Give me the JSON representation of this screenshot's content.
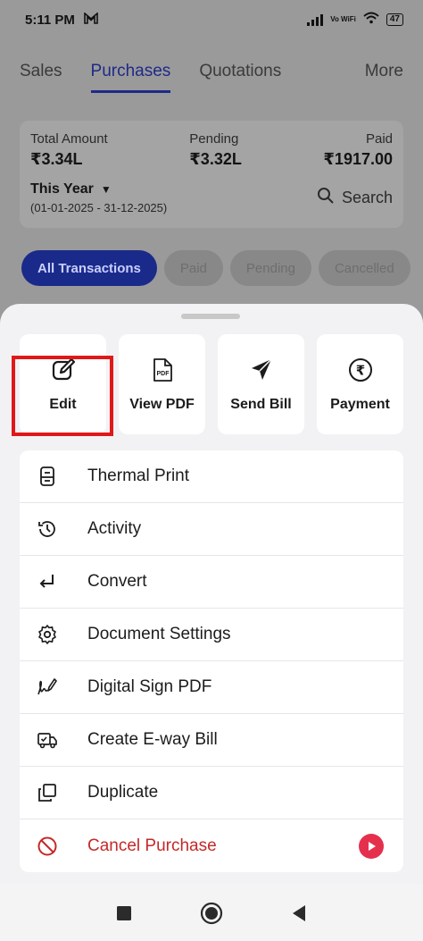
{
  "status_bar": {
    "time": "5:11 PM",
    "network": "Vo WiFi",
    "battery": "47"
  },
  "tabs": [
    {
      "label": "Sales"
    },
    {
      "label": "Purchases"
    },
    {
      "label": "Quotations"
    },
    {
      "label": "More"
    }
  ],
  "summary": {
    "total_label": "Total Amount",
    "total_value": "₹3.34L",
    "pending_label": "Pending",
    "pending_value": "₹3.32L",
    "paid_label": "Paid",
    "paid_value": "₹1917.00",
    "period_label": "This Year",
    "period_range": "(01-01-2025 - 31-12-2025)",
    "search_label": "Search"
  },
  "filters": [
    {
      "label": "All Transactions"
    },
    {
      "label": "Paid"
    },
    {
      "label": "Pending"
    },
    {
      "label": "Cancelled"
    }
  ],
  "sheet": {
    "actions": [
      {
        "label": "Edit",
        "icon": "edit-icon"
      },
      {
        "label": "View PDF",
        "icon": "pdf-icon"
      },
      {
        "label": "Send Bill",
        "icon": "send-icon"
      },
      {
        "label": "Payment",
        "icon": "rupee-icon"
      }
    ],
    "menu": [
      {
        "label": "Thermal Print",
        "icon": "printer-icon"
      },
      {
        "label": "Activity",
        "icon": "history-icon"
      },
      {
        "label": "Convert",
        "icon": "convert-icon"
      },
      {
        "label": "Document Settings",
        "icon": "gear-icon"
      },
      {
        "label": "Digital Sign PDF",
        "icon": "signature-icon"
      },
      {
        "label": "Create E-way Bill",
        "icon": "truck-icon"
      },
      {
        "label": "Duplicate",
        "icon": "duplicate-icon"
      },
      {
        "label": "Cancel Purchase",
        "icon": "cancel-icon"
      }
    ]
  },
  "colors": {
    "accent": "#1e2a88",
    "danger": "#c62828",
    "highlight": "#e01818",
    "sheet_bg": "#f2f2f4"
  }
}
